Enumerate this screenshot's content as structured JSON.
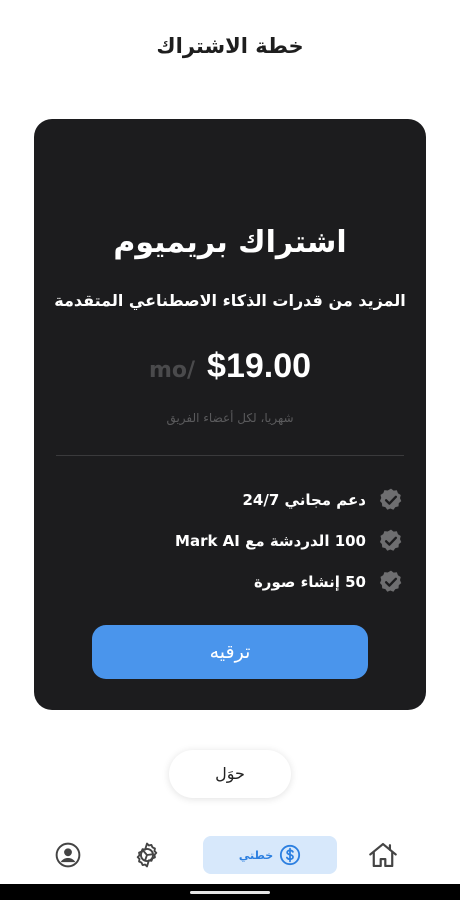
{
  "header": {
    "title": "خطة الاشتراك"
  },
  "plan": {
    "name": "اشتراك بريميوم",
    "description": "المزيد من قدرات الذكاء الاصطناعي المتقدمة",
    "price": "$19.00",
    "period": "mo/",
    "note": "شهريا، لكل أعضاء الفريق",
    "features": [
      {
        "label": "دعم مجاني 24/7"
      },
      {
        "label": "100 الدردشة مع Mark AI"
      },
      {
        "label": "50 إنشاء صورة"
      }
    ],
    "upgrade_label": "ترقيه"
  },
  "about": {
    "label": "حوَل"
  },
  "nav": {
    "plan_label": "خطتي",
    "icons": [
      "profile-icon",
      "settings-icon",
      "dollar-icon",
      "home-icon"
    ]
  },
  "colors": {
    "card_bg": "#1c1c1e",
    "accent": "#4a95ec",
    "nav_active_bg": "#d7e8fb",
    "nav_active_text": "#2c7fe0"
  }
}
